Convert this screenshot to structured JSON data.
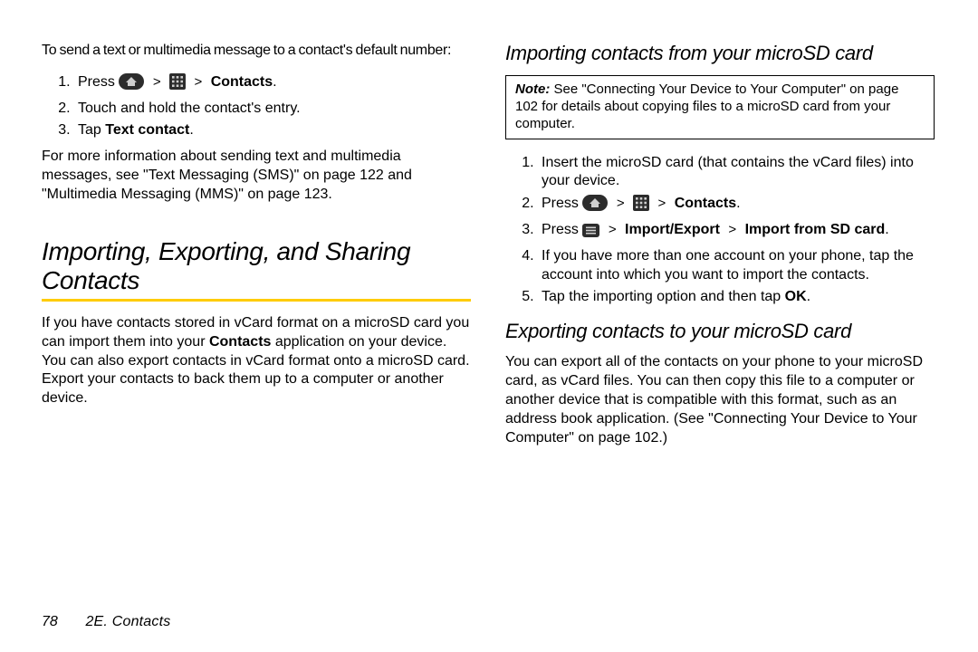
{
  "leftCol": {
    "introSend": "To send a text or multimedia message to a contact's default number:",
    "steps1": {
      "s1a": "Press",
      "s1b": "Contacts",
      "s2": "Touch and hold the contact's entry.",
      "s3a": "Tap ",
      "s3b": "Text contact",
      "s3c": "."
    },
    "moreInfo": "For more information about sending text and multimedia messages, see \"Text Messaging (SMS)\" on page 122 and \"Multimedia Messaging (MMS)\" on page 123.",
    "h1": "Importing, Exporting, and Sharing Contacts",
    "para1a": "If you have contacts stored in vCard format on a microSD card you can import them into your ",
    "para1b": "Contacts",
    "para1c": " application on your device. You can also export contacts in vCard format onto a microSD card. Export your contacts to back them up to a computer or another device."
  },
  "rightCol": {
    "h2a": "Importing contacts from your microSD card",
    "noteLabel": "Note:",
    "noteText": " See \"Connecting Your Device to Your Computer\" on page 102 for details about copying files to a microSD card from your computer.",
    "steps2": {
      "s1": "Insert the microSD card (that contains the vCard files) into your device.",
      "s2a": "Press",
      "s2b": "Contacts",
      "s3a": "Press",
      "s3b": "Import/Export",
      "s3c": "Import from SD card",
      "s4": "If you have more than one account on your phone, tap the account into which you want to import the contacts.",
      "s5a": "Tap the importing option and then tap ",
      "s5b": "OK",
      "s5c": "."
    },
    "h2b": "Exporting contacts to your microSD card",
    "para2": "You can export all of the contacts on your phone to your microSD card, as vCard files. You can then copy this file to a computer or another device that is compatible with this format, such as an address book application. (See \"Connecting Your Device to Your Computer\" on page 102.)"
  },
  "footer": {
    "pageNum": "78",
    "sectionLabel": "2E. Contacts"
  },
  "gt": ">"
}
